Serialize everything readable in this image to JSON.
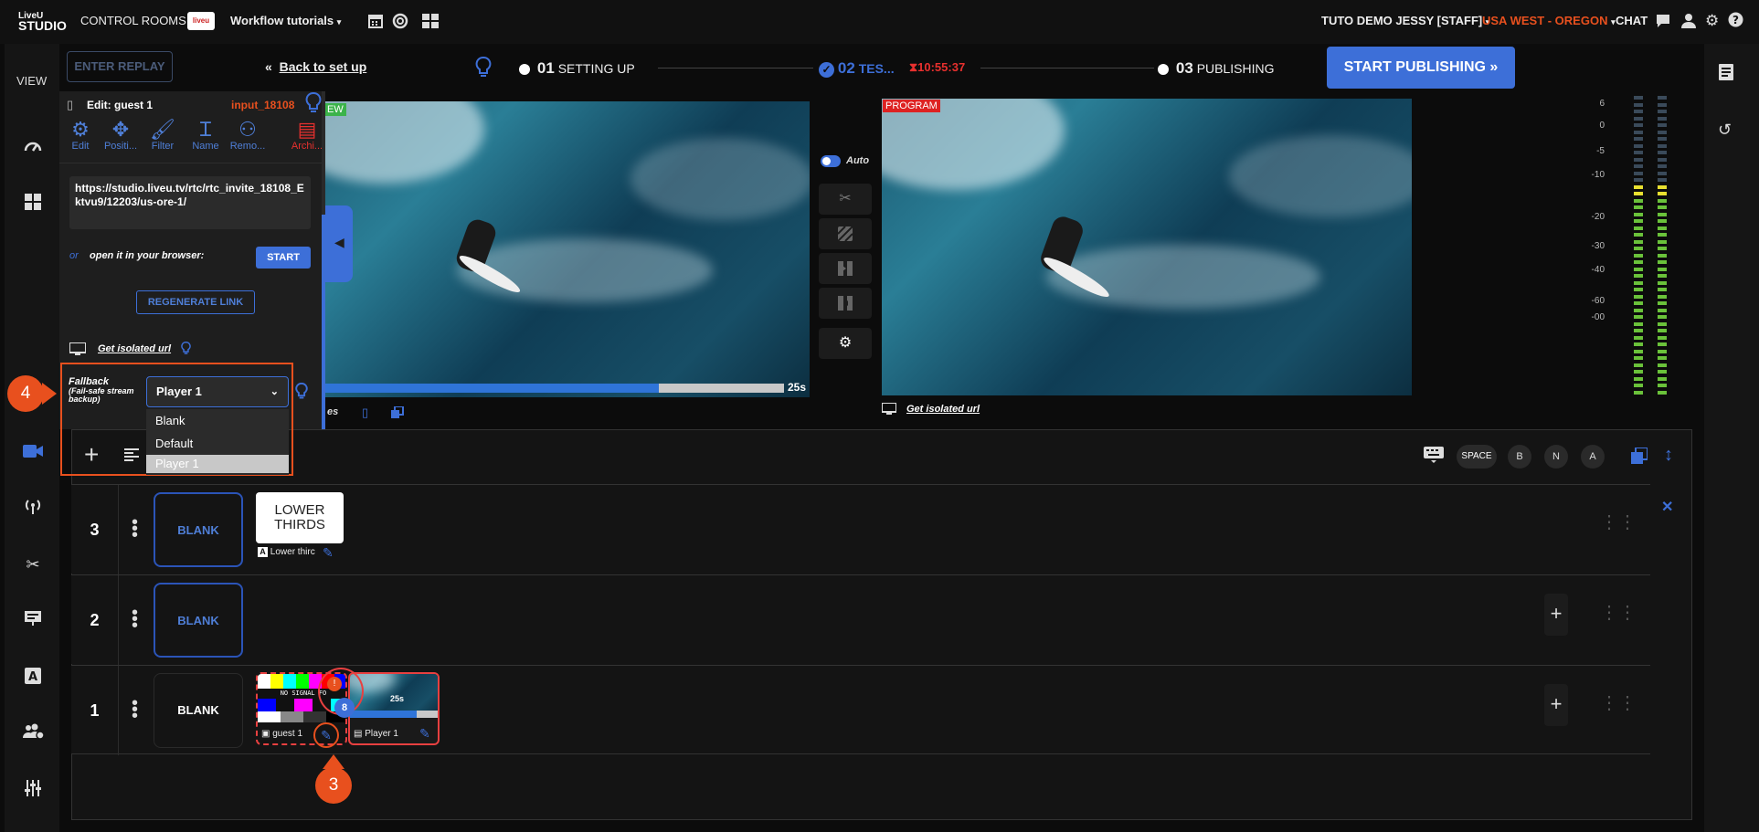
{
  "top_bar": {
    "logo_line1": "LiveU",
    "logo_line2": "STUDIO",
    "control_rooms": "CONTROL ROOMS",
    "room_badge": "liveu",
    "room_name": "Workflow tutorials",
    "user": "TUTO DEMO JESSY [STAFF]",
    "region": "USA WEST - OREGON",
    "chat": "CHAT"
  },
  "toolbar": {
    "enter_replay": "ENTER REPLAY",
    "back_to_setup": "Back to set up",
    "step1_num": "01",
    "step1_label": "SETTING UP",
    "step2_num": "02",
    "step2_label": "TES...",
    "timer": "10:55:37",
    "step3_num": "03",
    "step3_label": "PUBLISHING",
    "start_publishing": "START PUBLISHING"
  },
  "left_rail": {
    "view_label": "VIEW"
  },
  "edit_panel": {
    "title": "Edit: guest 1",
    "input_id": "input_18108",
    "tools": [
      "Edit",
      "Positi...",
      "Filter",
      "Name",
      "Remo...",
      "Archi..."
    ],
    "url": "https://studio.liveu.tv/rtc/rtc_invite_18108_Ektvu9/12203/us-ore-1/",
    "or": "or",
    "open_browser": "open it in your browser:",
    "start": "START",
    "regenerate": "REGENERATE LINK",
    "isolated_url": "Get isolated url",
    "fallback_title": "Fallback",
    "fallback_sub": "(Fail-safe stream backup)",
    "fallback_selected": "Player 1",
    "fallback_options": [
      "Blank",
      "Default",
      "Player 1"
    ]
  },
  "preview": {
    "label": "EW",
    "progress_fraction": 0.73,
    "time": "25s",
    "bottom_label": "es"
  },
  "center_controls": {
    "auto_label": "Auto"
  },
  "program": {
    "label": "PROGRAM",
    "isolated_url": "Get isolated url"
  },
  "audio_meter": {
    "scale": [
      "6",
      "0",
      "-5",
      "-10",
      "-20",
      "-30",
      "-40",
      "-60",
      "-00"
    ]
  },
  "layers_toolbar": {
    "space": "SPACE",
    "b": "B",
    "n": "N",
    "a": "A"
  },
  "layers": [
    {
      "num": "3",
      "blank": "BLANK",
      "card_line1": "LOWER",
      "card_line2": "THIRDS",
      "card_label": "Lower thirc"
    },
    {
      "num": "2",
      "blank": "BLANK"
    },
    {
      "num": "1",
      "blank": "BLANK",
      "source1_label": "guest 1",
      "source1_text": "NO SIGNAL FO",
      "source2_label": "Player 1",
      "source2_time": "25s",
      "badge_count": "8"
    }
  ],
  "annotations": {
    "step3": "3",
    "step4": "4"
  },
  "colors": {
    "accent": "#3d6fd8",
    "alert": "#e8501e",
    "region": "#e8501e"
  }
}
